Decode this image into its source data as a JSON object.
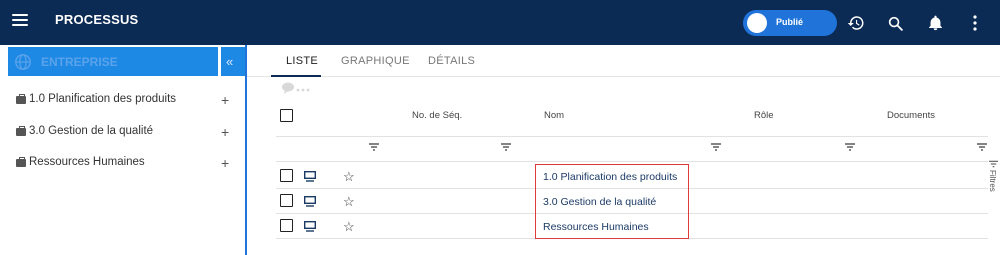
{
  "app": {
    "title": "PROCESSUS"
  },
  "header": {
    "publish_label": "Publié",
    "icons": [
      "menu-icon",
      "history-icon",
      "search-icon",
      "bell-icon",
      "more-vert-icon"
    ]
  },
  "sidebar": {
    "title": "ENTREPRISE",
    "collapse_glyph": "«",
    "items": [
      {
        "label": "1.0 Planification des produits",
        "action": "+"
      },
      {
        "label": "3.0 Gestion de la qualité",
        "action": "+"
      },
      {
        "label": "Ressources Humaines",
        "action": "+"
      }
    ]
  },
  "main": {
    "tabs": [
      {
        "label": "LISTE",
        "active": true
      },
      {
        "label": "GRAPHIQUE",
        "active": false
      },
      {
        "label": "DÉTAILS",
        "active": false
      }
    ],
    "columns": {
      "seq": "No. de Séq.",
      "name": "Nom",
      "role": "Rôle",
      "documents": "Documents"
    },
    "rows": [
      {
        "name": "1.0 Planification des produits"
      },
      {
        "name": "3.0 Gestion de la qualité"
      },
      {
        "name": "Ressources Humaines"
      }
    ],
    "filters_label": "Filtres"
  },
  "colors": {
    "topbar": "#0b2b55",
    "accent": "#1e88e5",
    "highlight": "#e03a3a"
  }
}
